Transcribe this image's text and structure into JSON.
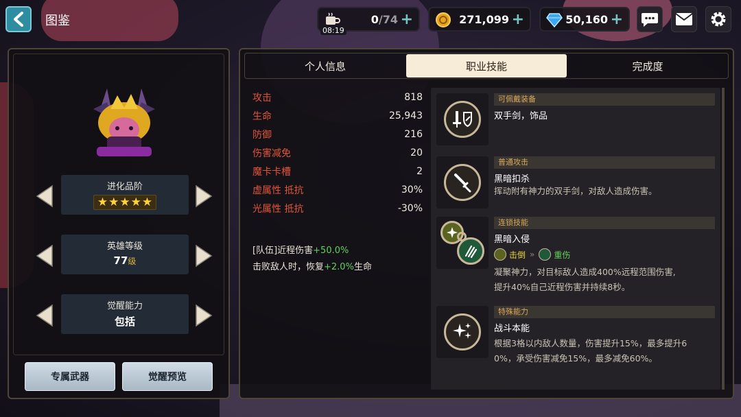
{
  "header": {
    "title": "图鉴",
    "stamina": {
      "current": "0",
      "max": "/74",
      "timer": "08:19"
    },
    "gold": "271,099",
    "gems": "50,160"
  },
  "hero": {
    "rows": [
      {
        "label": "进化品阶",
        "stars": 5
      },
      {
        "label": "英雄等级",
        "value": "77",
        "unit": "级"
      },
      {
        "label": "觉醒能力",
        "value": "包括"
      }
    ],
    "buttons": {
      "weapon": "专属武器",
      "awaken_preview": "觉醒预览"
    }
  },
  "tabs": [
    {
      "label": "个人信息",
      "active": false
    },
    {
      "label": "职业技能",
      "active": true
    },
    {
      "label": "完成度",
      "active": false
    }
  ],
  "stats": [
    {
      "k": "攻击",
      "v": "818"
    },
    {
      "k": "生命",
      "v": "25,943"
    },
    {
      "k": "防御",
      "v": "216"
    },
    {
      "k": "伤害减免",
      "v": "20"
    },
    {
      "k": "魔卡卡槽",
      "v": "2"
    },
    {
      "k": "虚属性 抵抗",
      "v": "30%"
    },
    {
      "k": "光属性 抵抗",
      "v": "-30%"
    }
  ],
  "buffs": {
    "line1_pre": "[队伍]近程伤害",
    "line1_val": "+50.0%",
    "line2_pre": "击败敌人时，恢复",
    "line2_val": "+2.0%",
    "line2_post": "生命"
  },
  "skills": {
    "equip": {
      "header": "可佩戴装备",
      "name": "双手剑，饰品"
    },
    "basic": {
      "header": "普通攻击",
      "name": "黑暗扣杀",
      "desc": "挥动附有神力的双手剑，对敌人造成伤害。"
    },
    "chain": {
      "header": "连锁技能",
      "name": "黑暗入侵",
      "tag_from": "击倒",
      "tag_to": "重伤",
      "desc1": "凝聚神力，对目标敌人造成400%远程范围伤害,",
      "desc2": "提升40%自己近程伤害并持续8秒。"
    },
    "special": {
      "header": "特殊能力",
      "name": "战斗本能",
      "desc1": "根据3格以内敌人数量，伤害提升15%，最多提升6",
      "desc2": "0%，承受伤害减免15%，最多减免60%。"
    }
  },
  "colors": {
    "accent_red": "#e0553a",
    "accent_green": "#5fd35a",
    "gold_star": "#ffd33c",
    "tab_active_bg": "#f6ecd8",
    "back_btn": "#2f8da1"
  }
}
